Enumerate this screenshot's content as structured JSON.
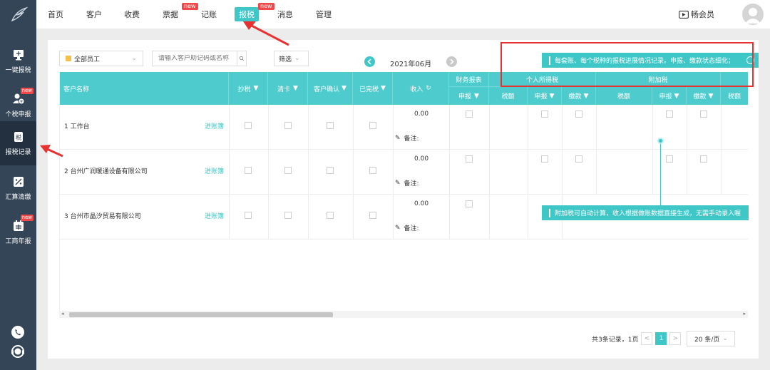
{
  "sidebar": {
    "items": [
      {
        "label": "一键报税",
        "icon": "monitor-icon",
        "new": ""
      },
      {
        "label": "个税申报",
        "icon": "person-tax-icon",
        "new": "new"
      },
      {
        "label": "报税记录",
        "icon": "tax-record-icon",
        "new": ""
      },
      {
        "label": "汇算清缴",
        "icon": "calculator-icon",
        "new": ""
      },
      {
        "label": "工商年报",
        "icon": "calendar-icon",
        "new": "new"
      }
    ]
  },
  "nav": {
    "items": [
      "首页",
      "客户",
      "收费",
      "票据",
      "记账",
      "报税",
      "消息",
      "管理"
    ],
    "new_label": "new",
    "member": "畅会员"
  },
  "toolbar": {
    "staff_select": "全部员工",
    "search_placeholder": "请输入客户助记码或名称",
    "filter": "筛选",
    "period": "2021年06月"
  },
  "table": {
    "headers": {
      "customer": "客户名称",
      "chaoshui": "抄税",
      "qingka": "清卡",
      "confirm": "客户确认",
      "finished": "已完税",
      "income": "收入",
      "finance_report": "财务报表",
      "personal_tax": "个人所得税",
      "addl_tax": "附加税",
      "declare": "申报",
      "tax_amount": "税额",
      "pay": "缴款"
    },
    "rows": [
      {
        "no": "1",
        "name": "工作台",
        "link": "进账簿",
        "income": "0.00",
        "note": "备注:"
      },
      {
        "no": "2",
        "name": "台州广润暖通设备有限公司",
        "link": "进账簿",
        "income": "0.00",
        "note": "备注:"
      },
      {
        "no": "3",
        "name": "台州市晶汐贸易有限公司",
        "link": "进账簿",
        "income": "0.00",
        "note": "备注:"
      }
    ]
  },
  "tips": {
    "top": "每套账、每个税种的报税进展情况记录。申报、缴款状态细化；",
    "bottom": "附加税可自动计算，收入根据做账数据直接生成，无需手动录入喔"
  },
  "pager": {
    "summary": "共3条记录，1页",
    "current": "1",
    "size": "20 条/页"
  },
  "colors": {
    "accent": "#3fc6c6",
    "sidebar": "#344558",
    "alert": "#e83232"
  }
}
